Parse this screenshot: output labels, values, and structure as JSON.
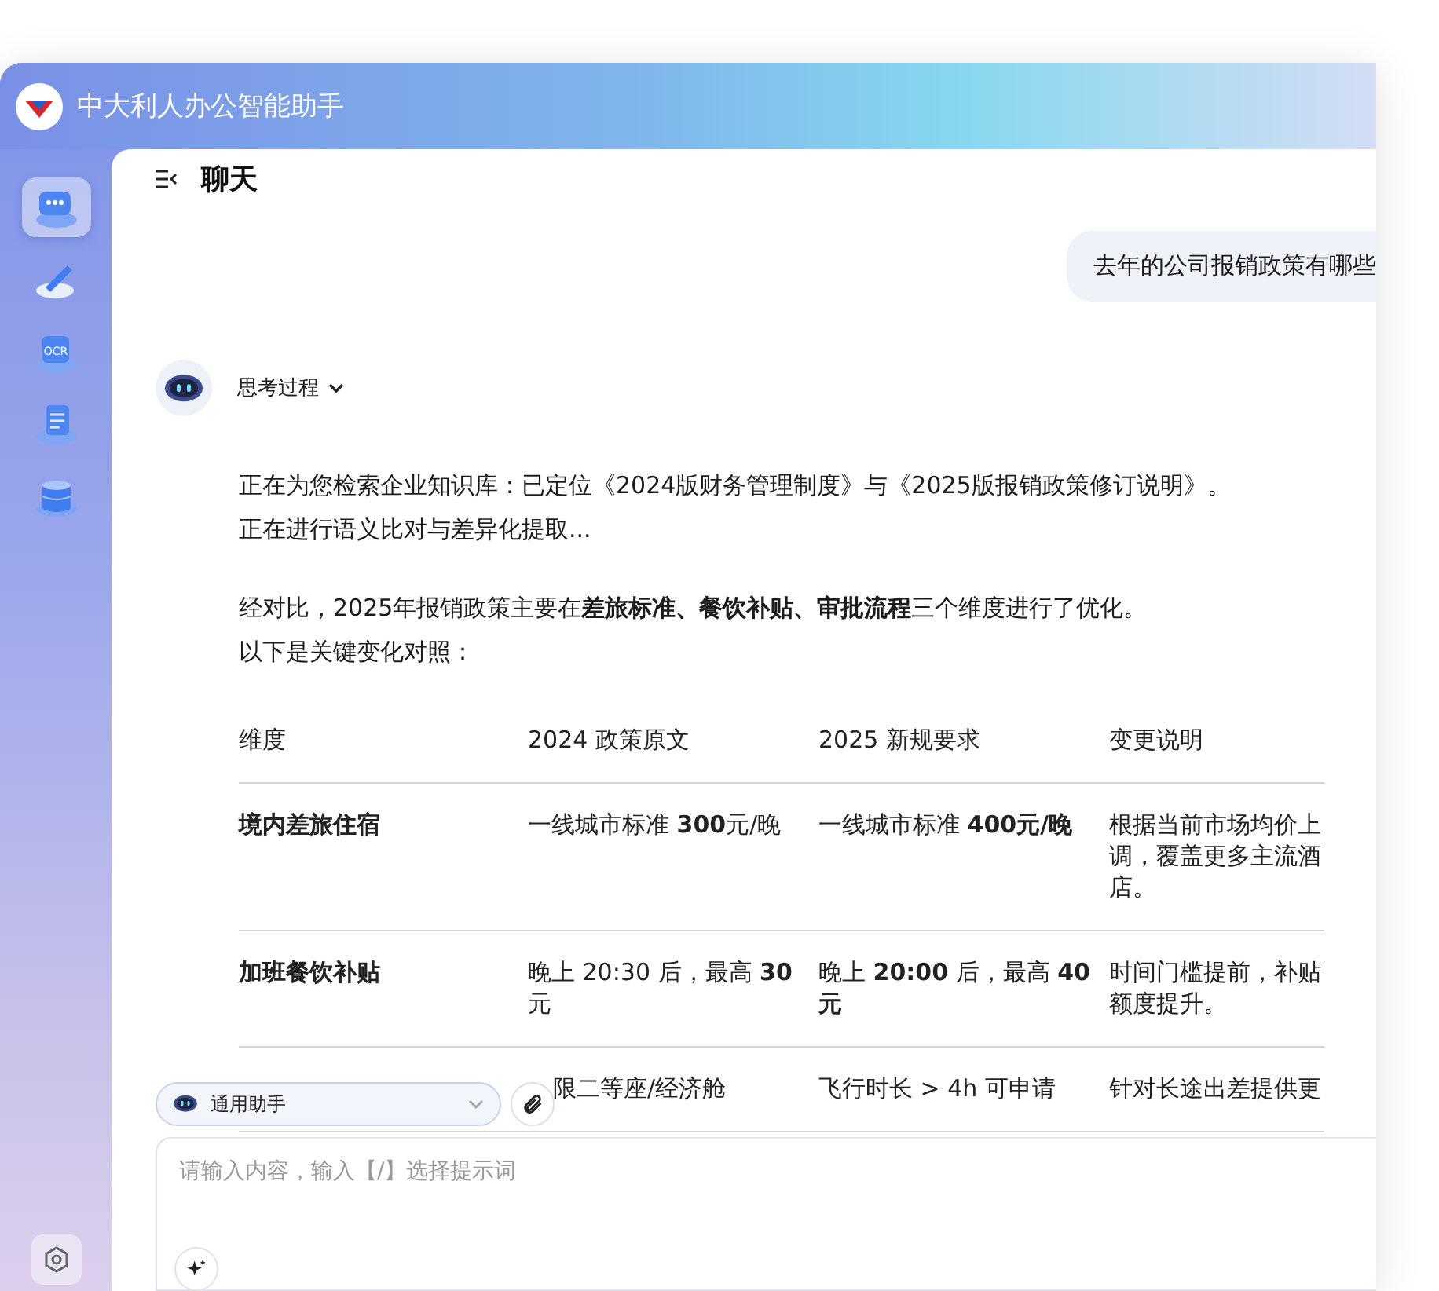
{
  "app": {
    "title": "中大利人办公智能助手"
  },
  "sidebar": {
    "items": [
      {
        "kind": "chat",
        "selected": true
      },
      {
        "kind": "write",
        "selected": false
      },
      {
        "kind": "ocr",
        "selected": false,
        "label": "OCR"
      },
      {
        "kind": "document",
        "selected": false
      },
      {
        "kind": "database",
        "selected": false
      }
    ]
  },
  "chat": {
    "title": "聊天",
    "user_message": "去年的公司报销政策有哪些",
    "thinking": {
      "label": "思考过程",
      "expanded": false
    },
    "thinking_lines": [
      "正在为您检索企业知识库：已定位《2024版财务管理制度》与《2025版报销政策修订说明》。",
      "正在进行语义比对与差异化提取..."
    ],
    "answer_lines": [
      "经对比，2025年报销政策主要在**差旅标准、餐饮补贴、审批流程**三个维度进行了优化。",
      "以下是关键变化对照："
    ],
    "table": {
      "columns": [
        "维度",
        "2024 政策原文",
        "2025 新规要求",
        "变更说明"
      ],
      "rows": [
        [
          "**境内差旅住宿**",
          "一线城市标准 **300**元/晚",
          "一线城市标准 **400元/晚**",
          "根据当前市场均价上调，覆盖更多主流酒店。"
        ],
        [
          "**加班餐饮补贴**",
          "晚上 20:30 后，最高 **30** 元",
          "晚上 **20:00** 后，最高 **40 元**",
          "时间门槛提前，补贴额度提升。"
        ],
        [
          "",
          "限二等座/经济舱",
          "飞行时长 > 4h 可申请",
          "针对长途出差提供更"
        ]
      ]
    }
  },
  "composer": {
    "assistant": "通用助手",
    "placeholder": "请输入内容，输入【/】选择提示词"
  }
}
